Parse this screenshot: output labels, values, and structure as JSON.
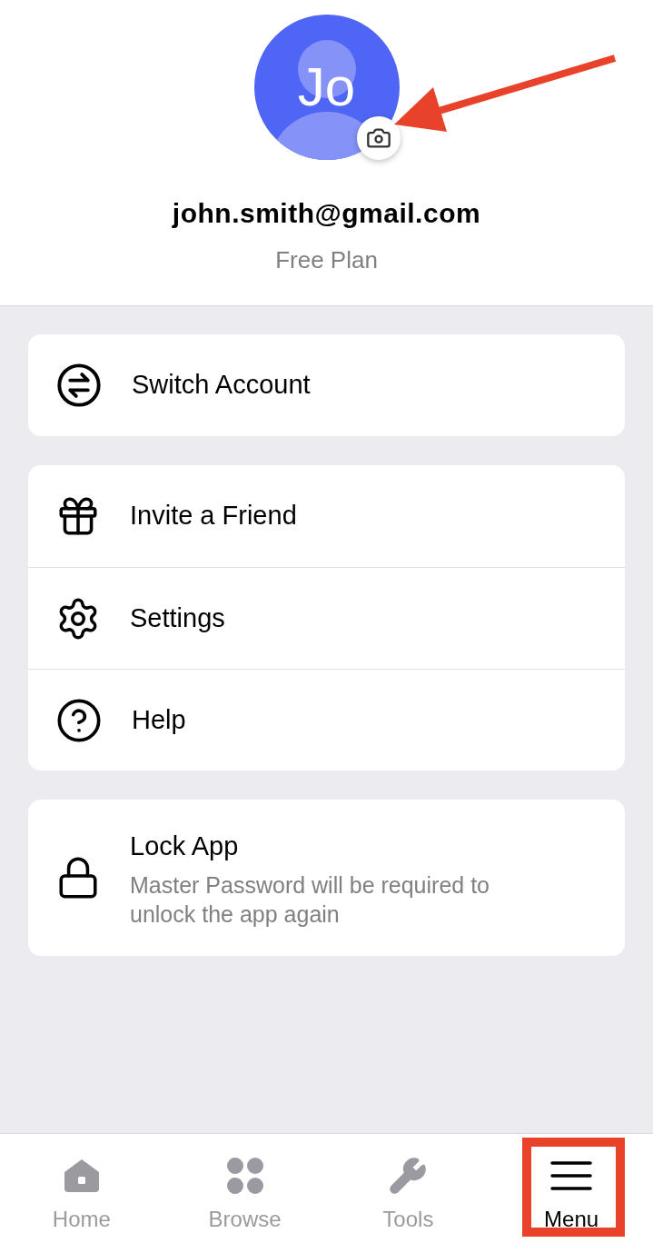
{
  "profile": {
    "initials": "Jo",
    "email": "john.smith@gmail.com",
    "plan": "Free Plan"
  },
  "groups": [
    {
      "items": [
        {
          "label": "Switch Account"
        }
      ]
    },
    {
      "items": [
        {
          "label": "Invite a Friend"
        },
        {
          "label": "Settings"
        },
        {
          "label": "Help"
        }
      ]
    },
    {
      "items": [
        {
          "label": "Lock App",
          "description": "Master Password will be required to unlock the app again"
        }
      ]
    }
  ],
  "tabs": [
    {
      "label": "Home",
      "selected": false
    },
    {
      "label": "Browse",
      "selected": false
    },
    {
      "label": "Tools",
      "selected": false
    },
    {
      "label": "Menu",
      "selected": true
    }
  ]
}
